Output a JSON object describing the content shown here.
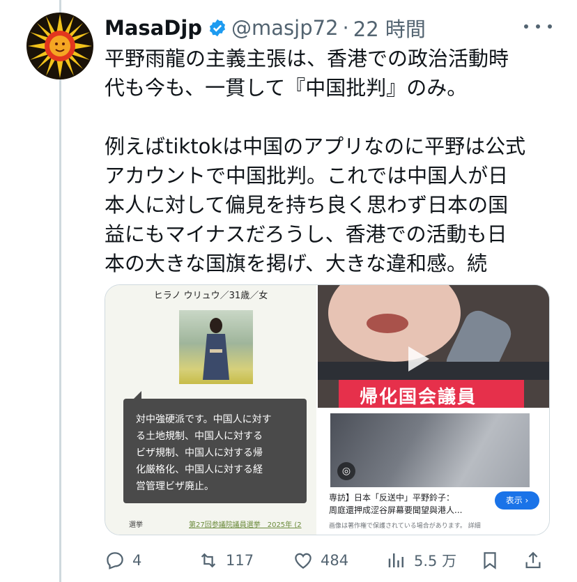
{
  "author": {
    "name": "MasaDjp",
    "handle": "@masjp72",
    "separator": "·",
    "time": "22 時間"
  },
  "tweet": {
    "text": "平野雨龍の主義主張は、香港での政治活動時\n代も今も、一貫して『中国批判』のみ。\n\n例えばtiktokは中国のアプリなのに平野は公式\nアカウントで中国批判。これでは中国人が日\n本人に対して偏見を持ち良く思わず日本の国\n益にもマイナスだろうし、香港での活動も日\n本の大きな国旗を掲げ、大きな違和感。続"
  },
  "media": {
    "profile_card": {
      "title": "ヒラノ ウリュウ／31歳／女",
      "quote": "対中強硬派です。中国人に対す\nる土地規制、中国人に対する\nビザ規制、中国人に対する帰\n化厳格化、中国人に対する経\n営管理ビザ廃止。",
      "footer_label": "選挙",
      "footer_link": "第27回参議院議員選挙　2025年 (2"
    },
    "video_card": {
      "band_text": "帰化国会議員"
    },
    "article_card": {
      "title": "専訪】日本「反送中」平野鈴子：\n周庭還押成涩谷屏幕要聞望與港人...",
      "button": "表示 ›",
      "note": "画像は著作権で保護されている場合があります。 詳細"
    }
  },
  "actions": {
    "replies": "4",
    "retweets": "117",
    "likes": "484",
    "views": "5.5 万"
  },
  "colors": {
    "text": "#0f1419",
    "secondary": "#536471",
    "verified": "#1d9bf0",
    "link_button": "#1a73e8",
    "video_band": "#e6304b"
  },
  "icons": [
    "verified-badge-icon",
    "more-icon",
    "reply-icon",
    "retweet-icon",
    "like-icon",
    "views-icon",
    "bookmark-icon",
    "share-icon",
    "play-icon",
    "lens-icon"
  ]
}
